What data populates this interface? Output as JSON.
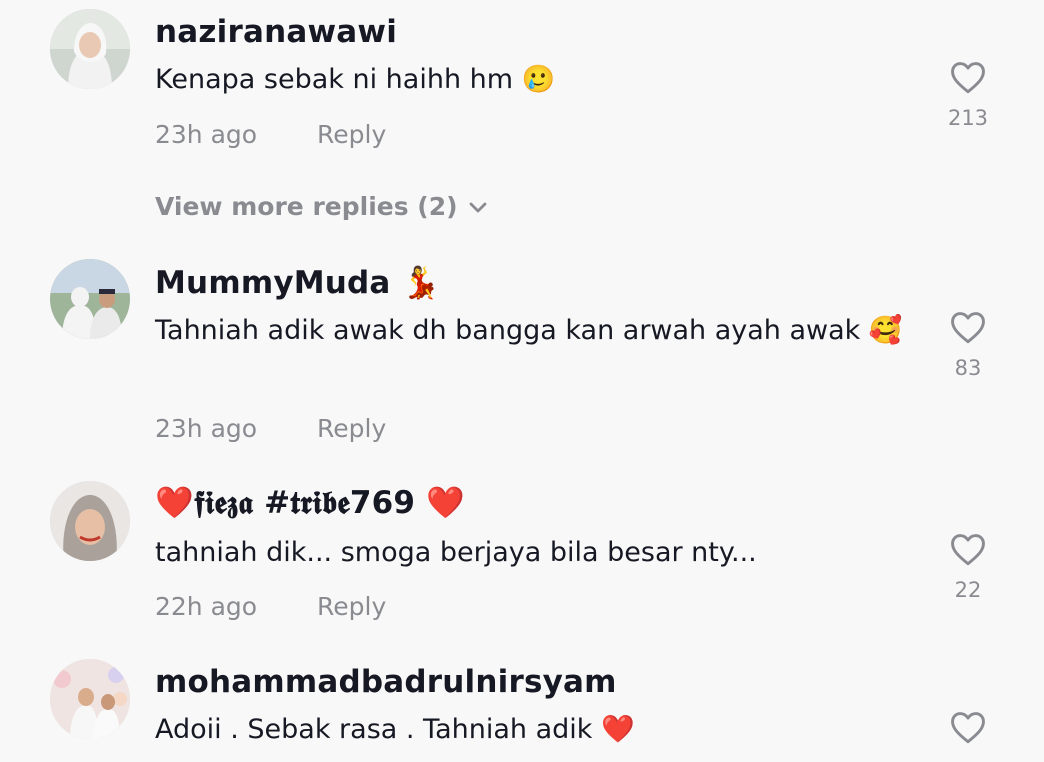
{
  "comments": [
    {
      "username": "naziranawawi",
      "text": "Kenapa sebak ni haihh hm 🥲",
      "time": "23h ago",
      "reply_label": "Reply",
      "likes": "213"
    },
    {
      "username": "MummyMuda 💃",
      "text": "Tahniah adik awak dh bangga kan arwah ayah awak 🥰",
      "time": "23h ago",
      "reply_label": "Reply",
      "likes": "83"
    },
    {
      "username": "❤️𝖋𝖎𝖊𝖟𝖆 #𝖙𝖗𝖎𝖇𝖊769 ❤️",
      "text": "tahniah dik... smoga berjaya bila besar nty...",
      "time": "22h ago",
      "reply_label": "Reply",
      "likes": "22"
    },
    {
      "username": "mohammadbadrulnirsyam",
      "text": "Adoii . Sebak rasa . Tahniah adik ❤️"
    }
  ],
  "view_more_replies": "View more replies (2)",
  "colors": {
    "background": "#f8f8f8",
    "primary_text": "#161823",
    "secondary_text": "#8a8b91"
  },
  "icons": {
    "like": "heart-outline-icon",
    "expand": "chevron-down-icon"
  }
}
